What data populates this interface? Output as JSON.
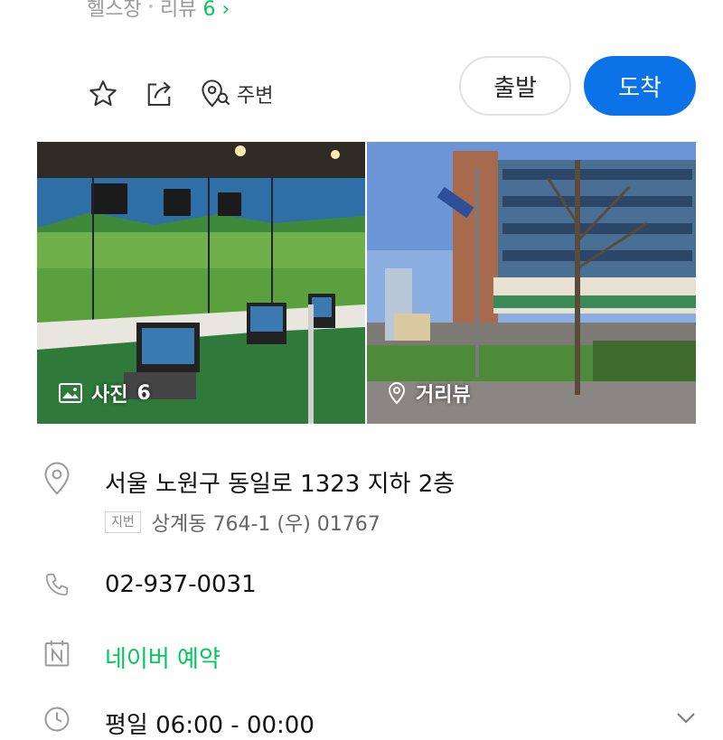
{
  "header": {
    "category": "헬스장",
    "reviews_label": "리뷰",
    "reviews_count": "6",
    "reviews_arrow": "›"
  },
  "actions": {
    "save_icon": "star-icon",
    "share_icon": "share-icon",
    "nearby_icon": "location-search-icon",
    "nearby_label": "주변",
    "depart_label": "출발",
    "arrive_label": "도착"
  },
  "photos": {
    "photo_label": "사진",
    "photo_count": "6",
    "street_label": "거리뷰"
  },
  "info": {
    "address": "서울 노원구 동일로 1323 지하 2층",
    "jibun_tag": "지번",
    "jibun_address": "상계동 764-1 (우) 01767",
    "phone": "02-937-0031",
    "booking": "네이버 예약",
    "hours": "평일 06:00 - 00:00"
  },
  "colors": {
    "brand_green": "#03c75a",
    "arrive_blue": "#0b72e7"
  }
}
